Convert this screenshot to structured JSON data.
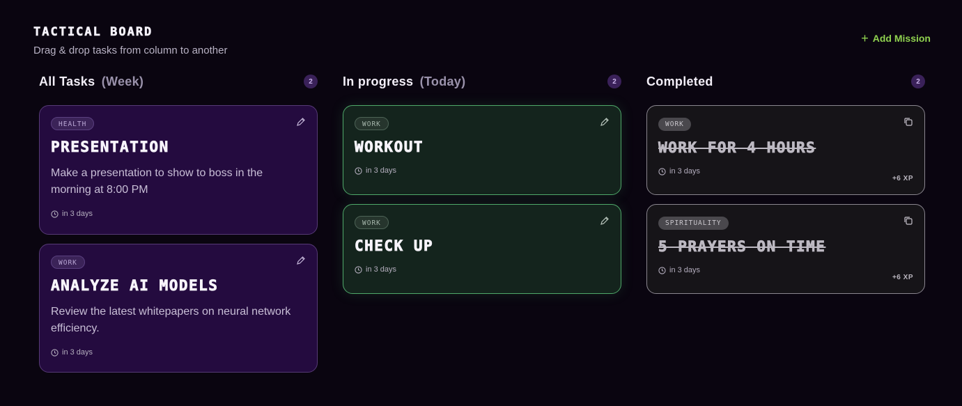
{
  "header": {
    "title": "TACTICAL BOARD",
    "subtitle": "Drag & drop tasks from column to another",
    "add_label": "Add Mission"
  },
  "columns": [
    {
      "title": "All Tasks",
      "qualifier": "(Week)",
      "count": "2",
      "cards": [
        {
          "tag": "HEALTH",
          "title": "PRESENTATION",
          "desc": "Make a presentation to show to boss in the morning at 8:00 PM",
          "due": "in 3 days"
        },
        {
          "tag": "WORK",
          "title": "ANALYZE AI MODELS",
          "desc": "Review the latest whitepapers on neural network efficiency.",
          "due": "in 3 days"
        }
      ]
    },
    {
      "title": "In progress",
      "qualifier": "(Today)",
      "count": "2",
      "cards": [
        {
          "tag": "WORK",
          "title": "WORKOUT",
          "due": "in 3 days"
        },
        {
          "tag": "WORK",
          "title": "CHECK UP",
          "due": "in 3 days"
        }
      ]
    },
    {
      "title": "Completed",
      "qualifier": "",
      "count": "2",
      "cards": [
        {
          "tag": "WORK",
          "title": "WORK FOR 4 HOURS",
          "due": "in 3 days",
          "xp": "+6 XP"
        },
        {
          "tag": "SPIRITUALITY",
          "title": "5 PRAYERS ON TIME",
          "due": "in 3 days",
          "xp": "+6 XP"
        }
      ]
    }
  ],
  "colors": {
    "accent_green": "#8fd14f",
    "purple_card": "#240b3f",
    "green_card": "#14241d",
    "gray_card": "#161418"
  },
  "icons": {
    "add": "plus-icon",
    "edit": "pencil-icon",
    "copy": "copy-icon",
    "due": "clock-icon"
  }
}
